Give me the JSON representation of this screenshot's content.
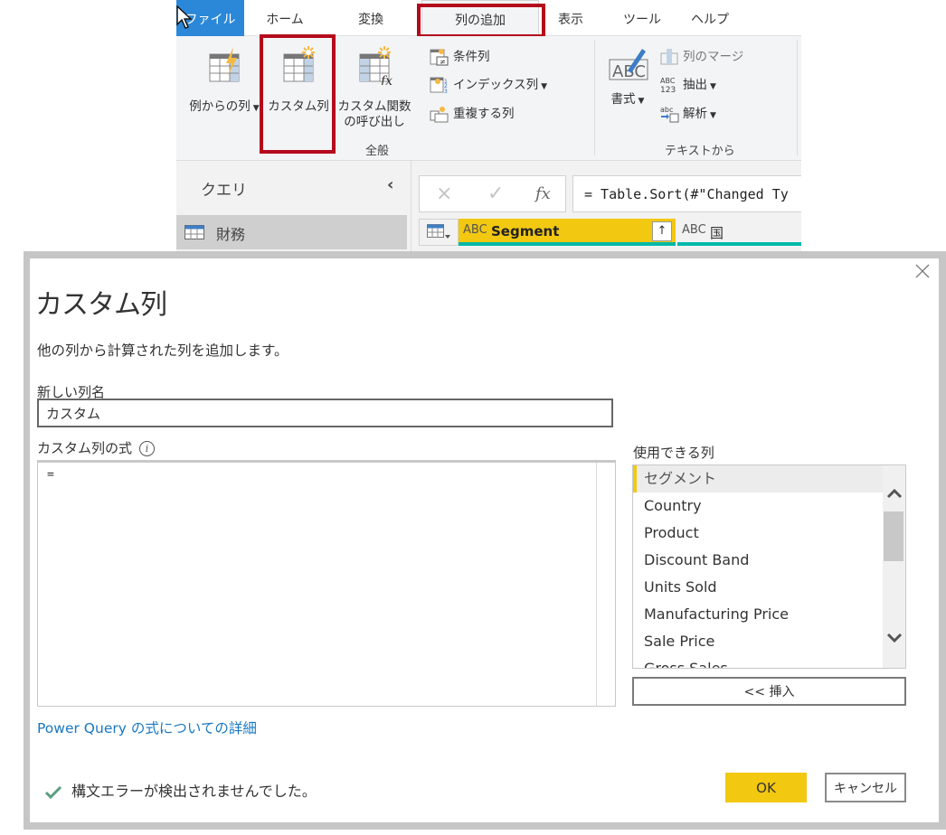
{
  "ribbon_tabs": {
    "file": "ファイル",
    "home": "ホーム",
    "transform": "変換",
    "add_column": "列の追加",
    "view": "表示",
    "tools": "ツール",
    "help": "ヘルプ",
    "active_tab": "列の追加"
  },
  "ribbon": {
    "general": {
      "column_from_examples": "例からの列",
      "custom_column": "カスタム列",
      "invoke_custom_function_line1": "カスタム関数",
      "invoke_custom_function_line2": "の呼び出し",
      "conditional_column": "条件列",
      "index_column": "インデックス列",
      "duplicate_column": "重複する列",
      "group_label": "全般"
    },
    "from_text": {
      "format": "書式",
      "merge_columns": "列のマージ",
      "extract": "抽出",
      "parse": "解析",
      "group_label": "テキストから"
    }
  },
  "queries_pane": {
    "title": "クエリ",
    "items": [
      {
        "label": "財務"
      }
    ]
  },
  "formula_bar": {
    "cancel_icon": "×",
    "confirm_icon": "✓",
    "fx_icon": "fx",
    "formula": "= Table.Sort(#\"Changed Ty"
  },
  "grid": {
    "columns": [
      {
        "type": "ABC",
        "name": "Segment",
        "selected": true
      },
      {
        "type": "ABC",
        "name": "国",
        "selected": false
      }
    ]
  },
  "dialog": {
    "title": "カスタム列",
    "description": "他の列から計算された列を追加します。",
    "new_column_name_label": "新しい列名",
    "new_column_name_value": "カスタム",
    "formula_label": "カスタム列の式",
    "formula_value": "=",
    "available_columns_label": "使用できる列",
    "available_columns": [
      "セグメント",
      "Country",
      "Product",
      "Discount Band",
      "Units Sold",
      "Manufacturing Price",
      "Sale Price",
      "Gross Sales"
    ],
    "selected_column": "セグメント",
    "insert_button": "<< 挿入",
    "learn_more_link": "Power Query の式についての詳細",
    "status_message": "構文エラーが検出されませんでした。",
    "ok_button": "OK",
    "cancel_button": "キャンセル"
  },
  "colors": {
    "accent_yellow": "#f2c811",
    "highlight_red": "#b40a1c",
    "file_tab_blue": "#2b88d8",
    "link_blue": "#1a78c2",
    "success_green": "#5a9e7f",
    "teal": "#01b8aa"
  }
}
